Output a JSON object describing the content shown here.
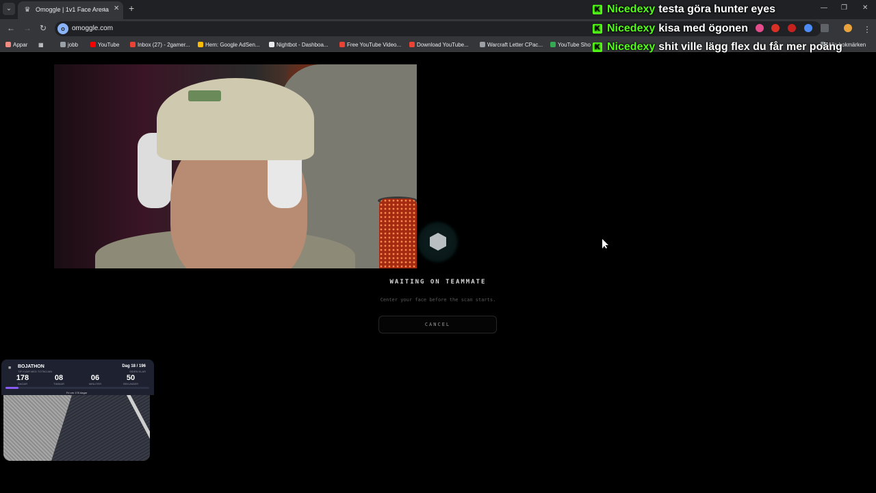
{
  "browser": {
    "tab_title": "Omoggle | 1v1 Face Arena",
    "url": "omoggle.com",
    "bookmarks": [
      {
        "label": "Appar",
        "color": "#f28b82"
      },
      {
        "label": "jobb",
        "color": "#9aa0a6"
      },
      {
        "label": "YouTube",
        "color": "#ff0000"
      },
      {
        "label": "Inbox (27) - 2gamer...",
        "color": "#ea4335"
      },
      {
        "label": "Hem: Google AdSen...",
        "color": "#fbbc04"
      },
      {
        "label": "Nightbot - Dashboa...",
        "color": "#e8eaed"
      },
      {
        "label": "Free YouTube Video...",
        "color": "#ea4335"
      },
      {
        "label": "Download YouTube...",
        "color": "#ea4335"
      },
      {
        "label": "Warcraft Letter CPac...",
        "color": "#9aa0a6"
      },
      {
        "label": "YouTube Sho",
        "color": "#34a853"
      },
      {
        "label": "Alla bokmärken",
        "color": "#9aa0a6"
      }
    ]
  },
  "chat": [
    {
      "user": "Nicedexy",
      "message": "testa göra hunter eyes"
    },
    {
      "user": "Nicedexy",
      "message": "kisa med ögonen"
    },
    {
      "user": "Nicedexy",
      "message": "shit ville lägg flex du får mer poäng"
    }
  ],
  "arena": {
    "status_title": "WAITING ON TEAMMATE",
    "status_sub": "Center your face before the scan starts.",
    "cancel_label": "CANCEL"
  },
  "widget": {
    "title": "BOJATHON",
    "subtitle": "TIP KVAR MED TOTBOJAN",
    "day": "Dag 18 / 196",
    "day_sub": "SIDEN KLAR",
    "stats": [
      {
        "value": "178",
        "label": "DAGAR"
      },
      {
        "value": "08",
        "label": "TIMMAR"
      },
      {
        "value": "06",
        "label": "MINUTER"
      },
      {
        "value": "50",
        "label": "SEKUNDER"
      }
    ],
    "progress": 0.09,
    "footer": "Fri om 178 dagar"
  },
  "colors": {
    "kick_green": "#53fc18",
    "progress": "#8a5cf6"
  }
}
